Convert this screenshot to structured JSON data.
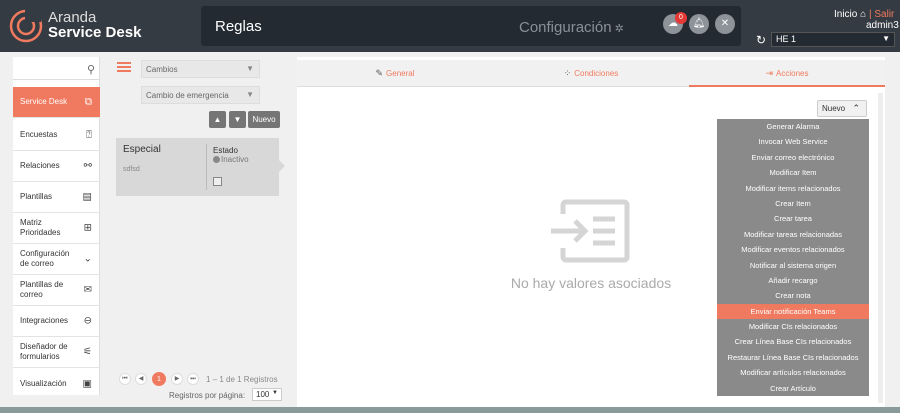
{
  "header": {
    "brand_line1": "Aranda",
    "brand_line2": "Service Desk",
    "page_title": "Reglas",
    "section_title": "Configuración",
    "notification_count": "0",
    "inicio_label": "Inicio",
    "salir_label": "Salir",
    "separator": "|",
    "username": "admin3",
    "project_select": "HE 1"
  },
  "sidebar": {
    "items": [
      {
        "label": "Service Desk",
        "icon": "copy-icon"
      },
      {
        "label": "Encuestas",
        "icon": "question-icon"
      },
      {
        "label": "Relaciones",
        "icon": "relations-icon"
      },
      {
        "label": "Plantillas",
        "icon": "document-icon"
      },
      {
        "label": "Matriz Prioridades",
        "icon": "table-icon"
      },
      {
        "label": "Configuración de correo",
        "icon": "chevron-down-icon"
      },
      {
        "label": "Plantillas de correo",
        "icon": "mail-icon"
      },
      {
        "label": "Integraciones",
        "icon": "integration-icon"
      },
      {
        "label": "Diseñador de formularios",
        "icon": "form-designer-icon"
      },
      {
        "label": "Visualización",
        "icon": "visualization-icon"
      }
    ]
  },
  "filters": {
    "type_select": "Cambios",
    "category_select": "Cambio de emergencia",
    "new_button": "Nuevo"
  },
  "rule_card": {
    "name": "Especial",
    "description": "sdfsd",
    "status_label": "Estado",
    "status_value": "Inactivo"
  },
  "pagination": {
    "current_page": "1",
    "info": "1 – 1 de 1 Registros",
    "rows_per_page_label": "Registros por página:",
    "rows_per_page": "100"
  },
  "tabs": [
    {
      "label": "General",
      "icon": "edit-icon"
    },
    {
      "label": "Condiciones",
      "icon": "conditions-icon"
    },
    {
      "label": "Acciones",
      "icon": "actions-icon"
    }
  ],
  "actions": {
    "new_button": "Nuevo",
    "empty_text": "No hay valores asociados",
    "menu_items": [
      "Generar Alarma",
      "Invocar Web Service",
      "Enviar correo electrónico",
      "Modificar Item",
      "Modificar items relacionados",
      "Crear Item",
      "Crear tarea",
      "Modificar tareas relacionadas",
      "Modificar eventos relacionados",
      "Notificar al sistema origen",
      "Añadir recargo",
      "Crear nota",
      "Enviar notificación Teams",
      "Modificar CIs relacionados",
      "Crear Línea Base CIs relacionados",
      "Restaurar Línea Base CIs relacionados",
      "Modificar artículos relacionados",
      "Crear Artículo"
    ],
    "highlighted_index": 12
  },
  "colors": {
    "accent": "#f07a5f",
    "topbar": "#353b42",
    "menu_bg": "#8a8a8a"
  }
}
